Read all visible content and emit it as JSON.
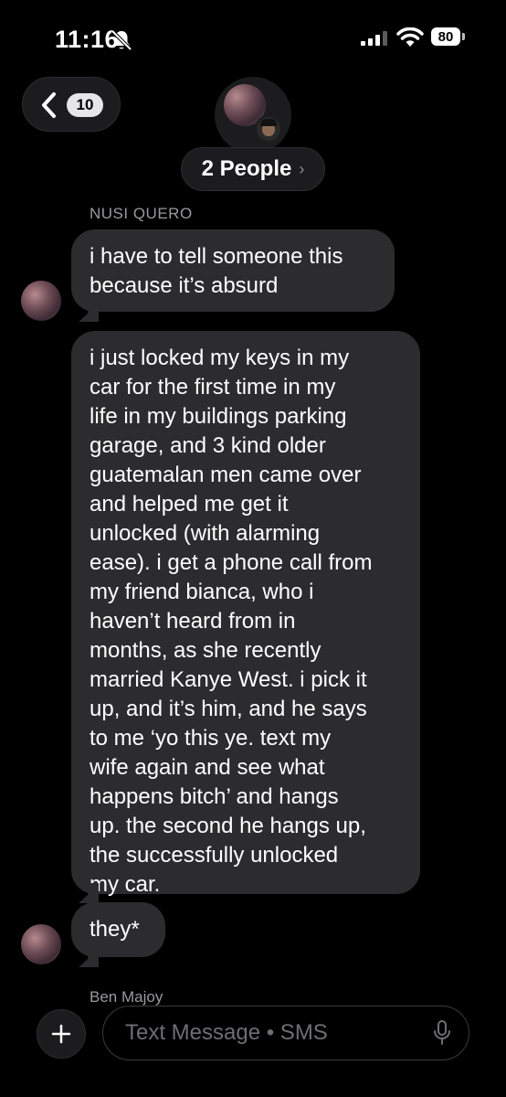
{
  "status": {
    "time": "11:16",
    "battery": "80"
  },
  "header": {
    "unread_count": "10",
    "group_label": "2 People",
    "chevron": "›"
  },
  "conversation": {
    "sender_name": "NUSI QUERO",
    "messages": [
      {
        "lines": [
          "i have to tell someone this",
          "because it’s absurd"
        ]
      },
      {
        "lines": [
          "i just locked my keys in my",
          "car for the first time in my",
          "life in my buildings parking",
          "garage, and 3 kind older",
          "guatemalan men came over",
          "and helped me get it",
          "unlocked (with alarming",
          "ease). i get a phone call from",
          "my friend bianca, who i",
          "haven’t heard from in",
          "months, as she recently",
          "married Kanye West. i pick it",
          "up, and it’s him, and he says",
          "to me ‘yo this ye. text my",
          "wife again and see what",
          "happens bitch’ and hangs",
          "up. the second he hangs up,",
          "the successfully unlocked",
          "my car."
        ]
      },
      {
        "lines": [
          "they*"
        ]
      }
    ],
    "next_sender": "Ben Majoy"
  },
  "input": {
    "placeholder": "Text Message • SMS"
  }
}
